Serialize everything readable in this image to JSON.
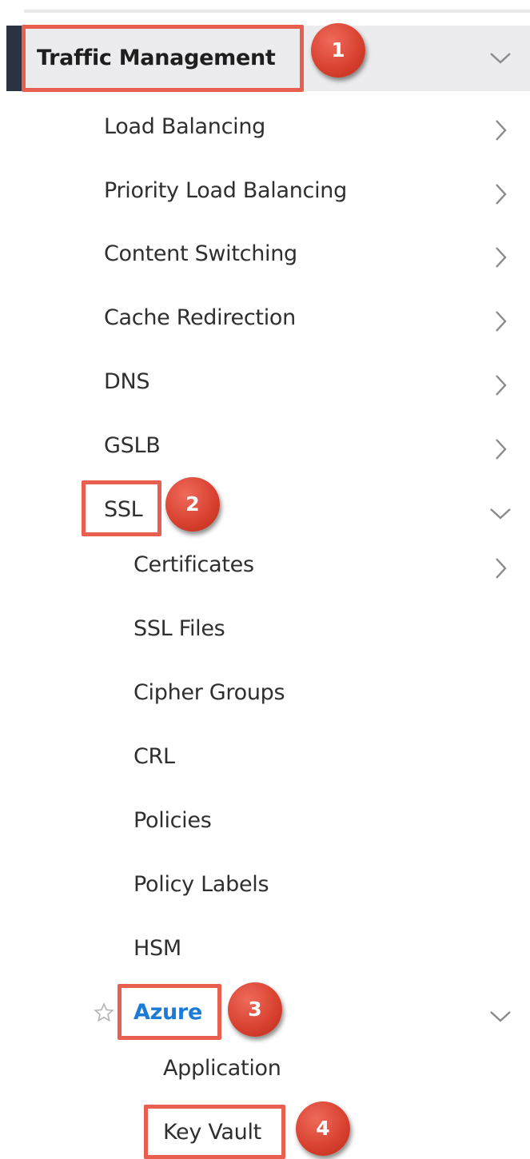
{
  "nav": {
    "traffic_management": "Traffic Management",
    "load_balancing": "Load Balancing",
    "priority_load_balancing": "Priority Load Balancing",
    "content_switching": "Content Switching",
    "cache_redirection": "Cache Redirection",
    "dns": "DNS",
    "gslb": "GSLB",
    "ssl": "SSL",
    "ssl_children": {
      "certificates": "Certificates",
      "ssl_files": "SSL Files",
      "cipher_groups": "Cipher Groups",
      "crl": "CRL",
      "policies": "Policies",
      "policy_labels": "Policy Labels",
      "hsm": "HSM",
      "azure": "Azure",
      "azure_children": {
        "application": "Application",
        "key_vault": "Key Vault"
      }
    }
  },
  "callouts": {
    "step1": "1",
    "step2": "2",
    "step3": "3",
    "step4": "4"
  },
  "icons": {
    "expanded": "chevron-down-icon",
    "collapsed": "chevron-right-icon",
    "favorite": "star-outline-icon"
  },
  "colors": {
    "active_bar": "#2b3340",
    "header_background": "#ececee",
    "selected_text": "#1b7bd6",
    "callout": "#e85f4f"
  }
}
